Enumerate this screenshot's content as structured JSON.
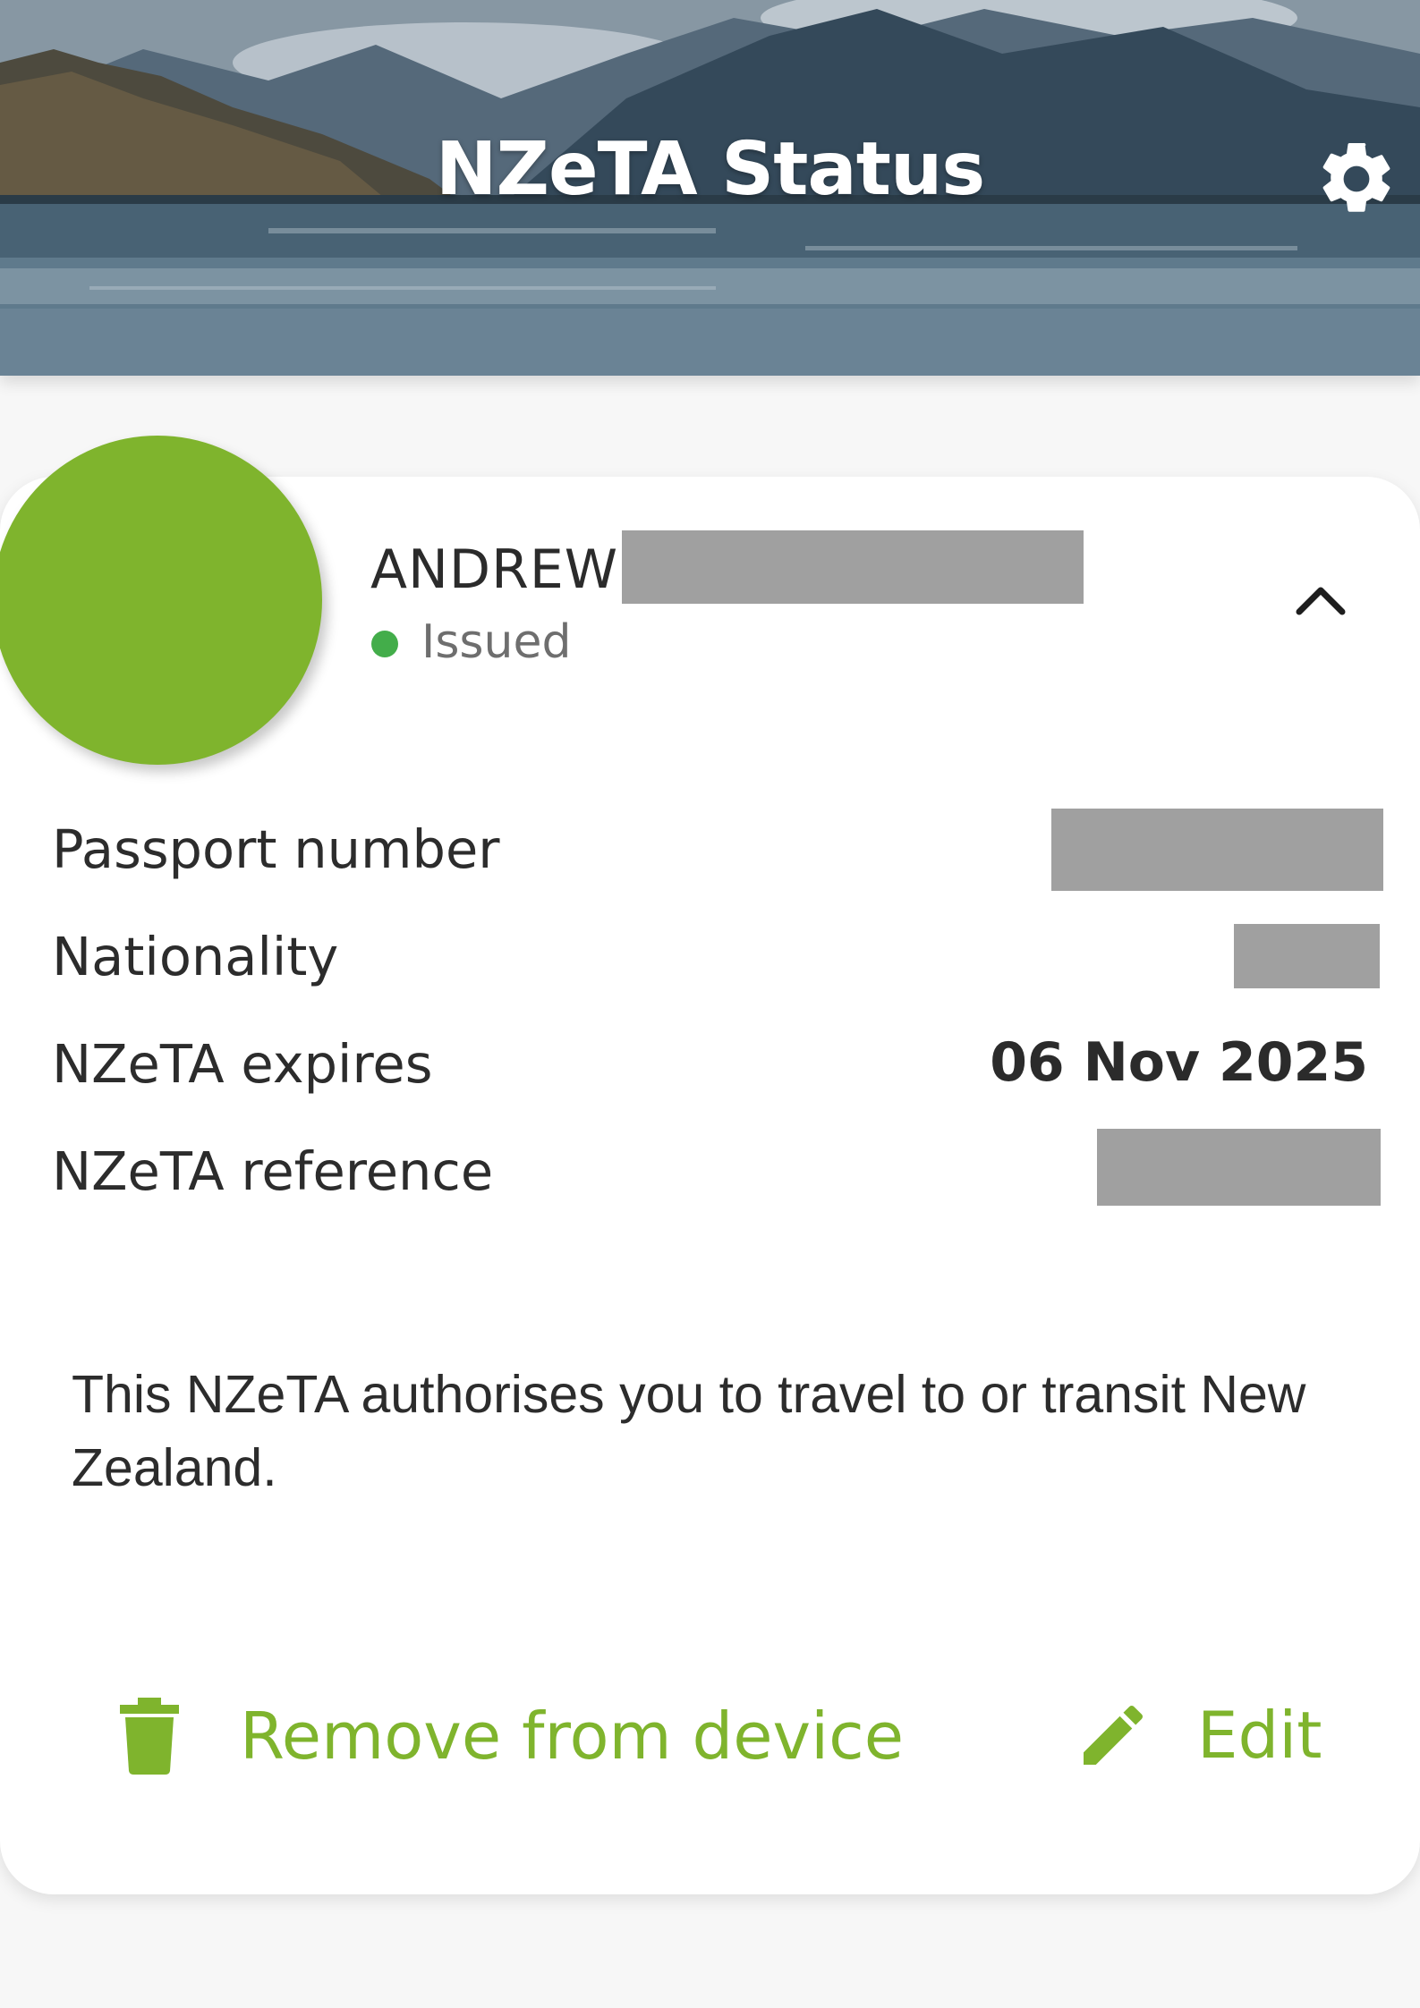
{
  "header": {
    "title": "NZeTA Status",
    "settings_icon": "gear-icon"
  },
  "traveller": {
    "first_name": "ANDREW",
    "status": "Issued",
    "status_color": "#43ad4a",
    "avatar_color": "#7fb42d",
    "collapse_icon": "chevron-up-icon"
  },
  "details": {
    "passport_label": "Passport number",
    "nationality_label": "Nationality",
    "expires_label": "NZeTA expires",
    "expires_value": "06 Nov 2025",
    "reference_label": "NZeTA reference"
  },
  "info": {
    "message": "This NZeTA authorises you to travel to or transit New Zealand."
  },
  "actions": {
    "remove_label": "Remove from device",
    "remove_icon": "trash-icon",
    "edit_label": "Edit",
    "edit_icon": "pencil-icon",
    "accent_color": "#7fb42d"
  }
}
